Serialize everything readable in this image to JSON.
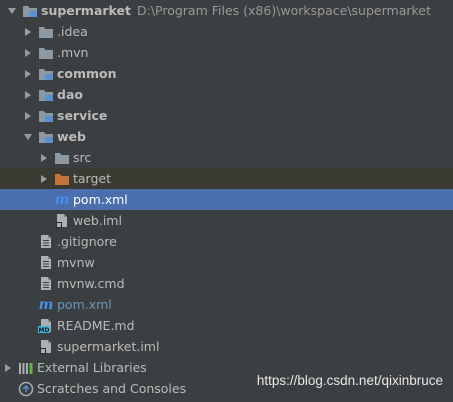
{
  "colors": {
    "background": "#3c3f41",
    "selected_row": "#4b6eaf",
    "excluded_row": "#3b3a32",
    "folder": "#8c99a3",
    "excluded_folder": "#c2733a",
    "maven_blue": "#4a8fe7",
    "modified_text": "#6897bb"
  },
  "tree": {
    "root": {
      "name": "supermarket",
      "path": "D:\\Program Files (x86)\\workspace\\supermarket"
    },
    "idea": ".idea",
    "mvn": ".mvn",
    "common": "common",
    "dao": "dao",
    "service": "service",
    "web": "web",
    "src": "src",
    "target": "target",
    "web_pom": "pom.xml",
    "web_iml": "web.iml",
    "gitignore": ".gitignore",
    "mvnw": "mvnw",
    "mvnw_cmd": "mvnw.cmd",
    "root_pom": "pom.xml",
    "readme": "README.md",
    "root_iml": "supermarket.iml",
    "external_libraries": "External Libraries",
    "scratches": "Scratches and Consoles"
  },
  "icons": {
    "maven_letter": "m",
    "markdown_badge": "MD"
  },
  "watermark": "https://blog.csdn.net/qixinbruce"
}
